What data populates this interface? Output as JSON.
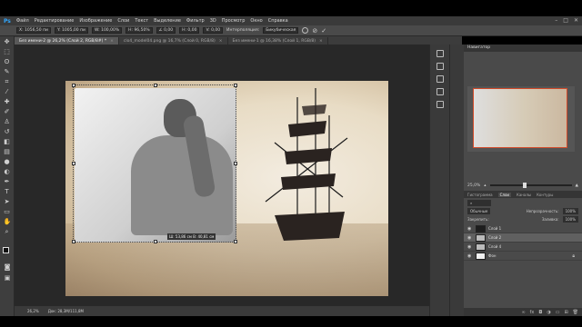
{
  "app": {
    "logo": "Ps"
  },
  "menu": [
    "Файл",
    "Редактирование",
    "Изображение",
    "Слои",
    "Текст",
    "Выделение",
    "Фильтр",
    "3D",
    "Просмотр",
    "Окно",
    "Справка"
  ],
  "window_controls": [
    "–",
    "□",
    "✕"
  ],
  "options": {
    "x": "X: 1056,50 пи",
    "y": "Y: 1005,00 пи",
    "w": "W: 100,00%",
    "h": "H: 96,50%",
    "angle": "∠ 0,00",
    "hskew": "H: 0,00",
    "vskew": "V: 0,00",
    "interp_label": "Интерполяция:",
    "interp_value": "Бикубическая"
  },
  "tabs": [
    {
      "label": "Без имени-2 @ 26,2% (Слой 2, RGB/8#) *",
      "active": true
    },
    {
      "label": "clo4_model04.png @ 16,7% (Слой 0, RGB/8)",
      "active": false
    },
    {
      "label": "Без имени-1 @ 16,38% (Слой 1, RGB/8)",
      "active": false
    }
  ],
  "canvas": {
    "tooltip": "Ш: 53,86 см В: 40,81 см"
  },
  "panels": {
    "navigator_title": "Навигатор",
    "zoom": "25,0%",
    "layer_tabs": [
      "Гистограмма",
      "Слои",
      "Каналы",
      "Контуры"
    ],
    "blend_mode": "Обычные",
    "opacity_label": "Непрозрачность:",
    "opacity_value": "100%",
    "lock_label": "Закрепить:",
    "fill_label": "Заливка:",
    "fill_value": "100%",
    "layers": [
      {
        "name": "Слой 1",
        "thumb": "dark",
        "selected": false
      },
      {
        "name": "Слой 2",
        "thumb": "gray",
        "selected": true
      },
      {
        "name": "Слой 4",
        "thumb": "gray",
        "selected": false
      },
      {
        "name": "Фон",
        "thumb": "white",
        "selected": false
      }
    ]
  },
  "status": {
    "zoom": "26,2%",
    "doc": "Док: 28,3М/111,8М"
  }
}
